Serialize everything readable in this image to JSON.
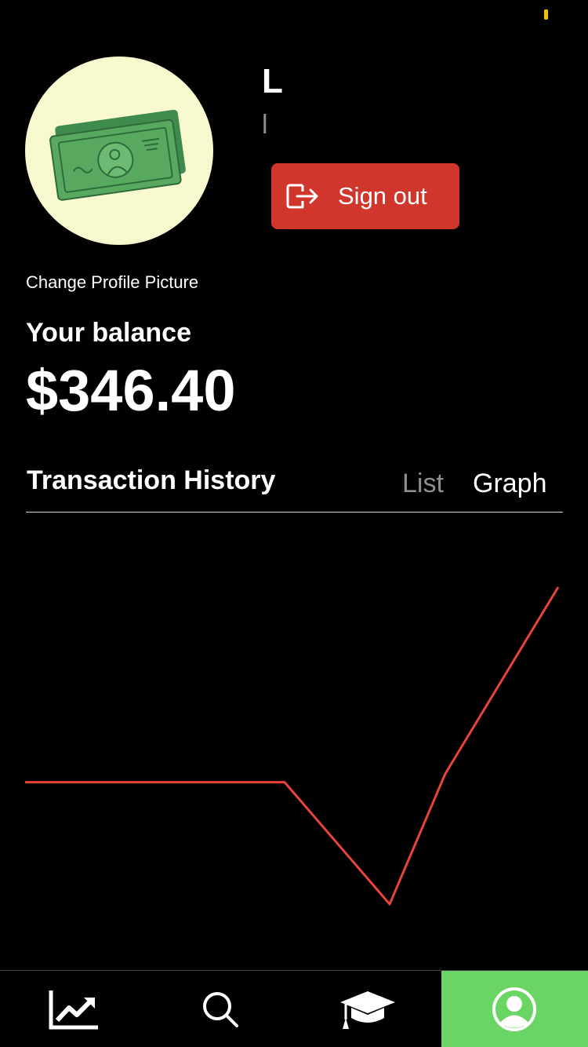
{
  "profile": {
    "name": "L",
    "email": "l",
    "change_picture_label": "Change Profile Picture",
    "avatar_icon": "money-bills-icon"
  },
  "signout": {
    "label": "Sign out",
    "icon": "logout-icon"
  },
  "balance": {
    "label": "Your balance",
    "amount": "$346.40"
  },
  "transactions": {
    "title": "Transaction History",
    "tabs": {
      "list": "List",
      "graph": "Graph"
    },
    "active_tab": "Graph"
  },
  "colors": {
    "signout": "#d0362c",
    "active_tab": "#6ad464",
    "line": "#e8443a",
    "avatar_bg": "#f8f9cf"
  },
  "chart_data": {
    "type": "line",
    "x": [
      0,
      1,
      2,
      3,
      4
    ],
    "series": [
      {
        "values": [
          0,
          0,
          -1,
          0.07,
          1.6
        ]
      }
    ],
    "grid": false
  },
  "tabbar": {
    "items": [
      {
        "icon": "chart-line-icon",
        "active": false
      },
      {
        "icon": "search-icon",
        "active": false
      },
      {
        "icon": "graduation-cap-icon",
        "active": false
      },
      {
        "icon": "profile-icon",
        "active": true
      }
    ]
  }
}
